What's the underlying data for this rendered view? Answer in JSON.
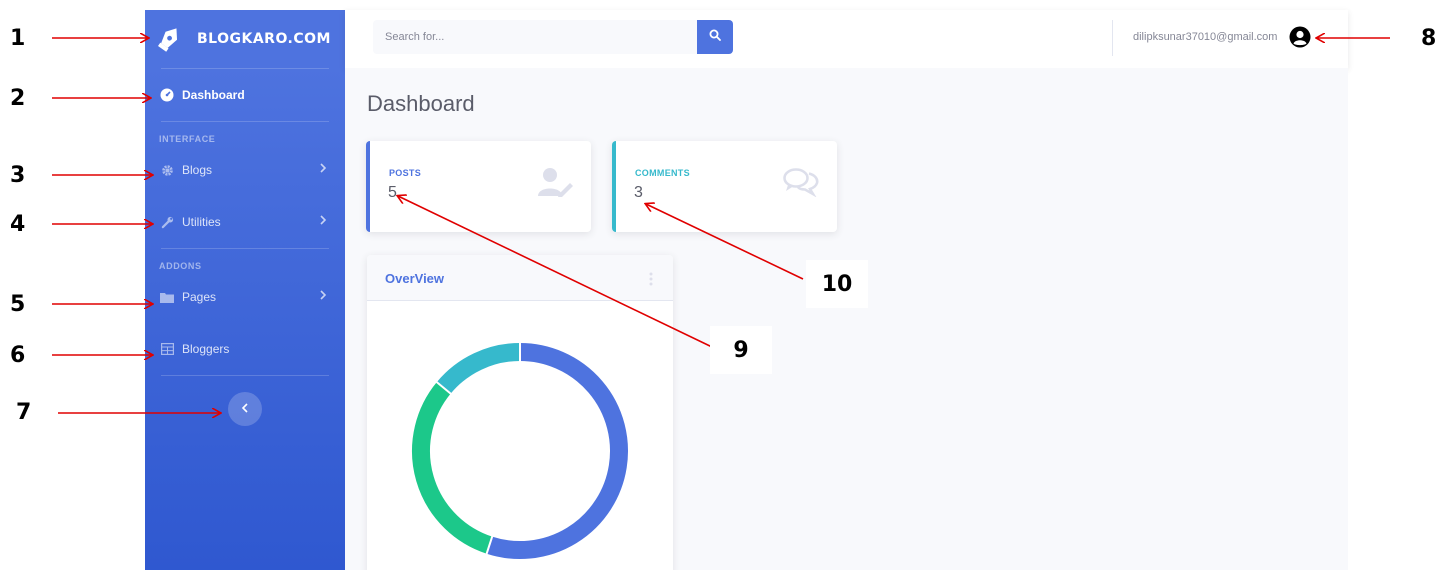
{
  "annotations": [
    "1",
    "2",
    "3",
    "4",
    "5",
    "6",
    "7",
    "8",
    "9",
    "10"
  ],
  "sidebar": {
    "brand": "BLOGKARO.COM",
    "dashboard_label": "Dashboard",
    "heading_interface": "INTERFACE",
    "blogs_label": "Blogs",
    "utilities_label": "Utilities",
    "heading_addons": "ADDONS",
    "pages_label": "Pages",
    "bloggers_label": "Bloggers",
    "icons": [
      "pen-nib-icon",
      "tachometer-icon",
      "cog-icon",
      "wrench-icon",
      "folder-icon",
      "table-icon",
      "chevron-left-icon",
      "chevron-right-icon"
    ]
  },
  "topbar": {
    "search_placeholder": "Search for...",
    "user_email": "dilipksunar37010@gmail.com",
    "icons": [
      "search-icon",
      "user-circle-icon"
    ]
  },
  "main": {
    "page_title": "Dashboard",
    "cards": {
      "posts_label": "POSTS",
      "posts_value": "5",
      "comments_label": "COMMENTS",
      "comments_value": "3",
      "icons": [
        "user-edit-icon",
        "comments-icon"
      ]
    },
    "overview": {
      "title": "OverView",
      "icons": [
        "ellipsis-vertical-icon"
      ]
    }
  },
  "colors": {
    "primary": "#4e73df",
    "success": "#1cc88a",
    "info": "#36b9cc",
    "content_bg": "#f8f9fc",
    "annotation_red": "#e00000"
  },
  "chart_data": {
    "type": "pie",
    "variant": "donut",
    "values": [
      55,
      31,
      14
    ],
    "colors": [
      "#4e73df",
      "#1cc88a",
      "#36b9cc"
    ]
  }
}
